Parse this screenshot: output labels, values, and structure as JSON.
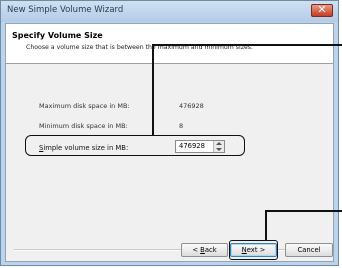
{
  "window": {
    "title": "New Simple Volume Wizard",
    "close_glyph": "✕"
  },
  "header": {
    "title": "Specify Volume Size",
    "subtitle": "Choose a volume size that is between the maximum and minimum sizes."
  },
  "rows": {
    "max_label": "Maximum disk space in MB:",
    "max_value": "476928",
    "min_label": "Minimum disk space in MB:",
    "min_value": "8",
    "simple_label_access_key": "S",
    "simple_label_rest": "imple volume size in MB:",
    "simple_value": "476928"
  },
  "buttons": {
    "back_prefix": "< ",
    "back_key": "B",
    "back_rest": "ack",
    "next_key": "N",
    "next_rest": "ext >",
    "cancel": "Cancel"
  },
  "icons": {
    "close": "close-icon",
    "spin_up": "arrow-up-icon",
    "spin_down": "arrow-down-icon"
  },
  "colors": {
    "title_bar": "#bcd3ea",
    "close_button": "#c63d23",
    "callout": "#111111"
  }
}
